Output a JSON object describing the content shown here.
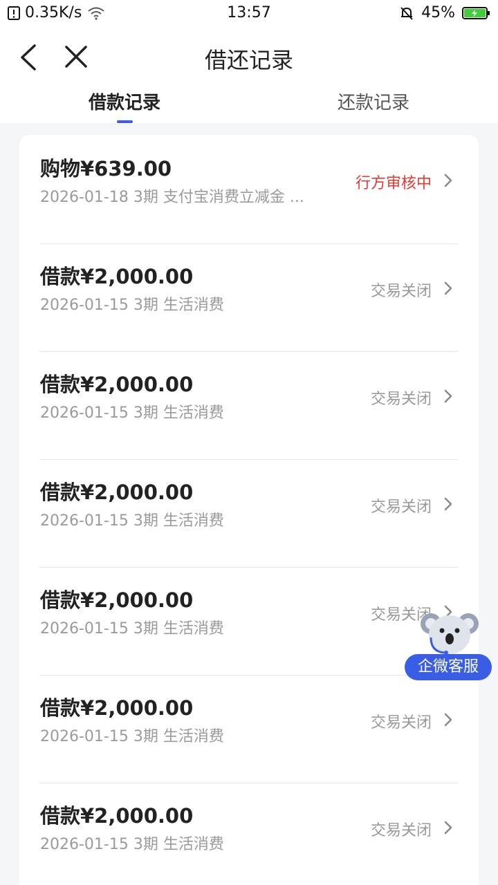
{
  "status_bar": {
    "speed": "0.35K/s",
    "time": "13:57",
    "battery": "45%"
  },
  "nav": {
    "title": "借还记录"
  },
  "tabs": [
    {
      "label": "借款记录"
    },
    {
      "label": "还款记录"
    }
  ],
  "records": [
    {
      "title": "购物¥639.00",
      "subtitle": "2026-01-18 3期  支付宝消费立减金 ...",
      "status": "行方审核中"
    },
    {
      "title": "借款¥2,000.00",
      "subtitle": "2026-01-15 3期  生活消费",
      "status": "交易关闭"
    },
    {
      "title": "借款¥2,000.00",
      "subtitle": "2026-01-15 3期  生活消费",
      "status": "交易关闭"
    },
    {
      "title": "借款¥2,000.00",
      "subtitle": "2026-01-15 3期  生活消费",
      "status": "交易关闭"
    },
    {
      "title": "借款¥2,000.00",
      "subtitle": "2026-01-15 3期  生活消费",
      "status": "交易关闭"
    },
    {
      "title": "借款¥2,000.00",
      "subtitle": "2026-01-15 3期  生活消费",
      "status": "交易关闭"
    },
    {
      "title": "借款¥2,000.00",
      "subtitle": "2026-01-15 3期  生活消费",
      "status": "交易关闭"
    }
  ],
  "customer_service": {
    "label": "企微客服"
  },
  "colors": {
    "accent": "#3a5de6",
    "status_pending": "#e53a32",
    "status_closed": "#999999"
  }
}
